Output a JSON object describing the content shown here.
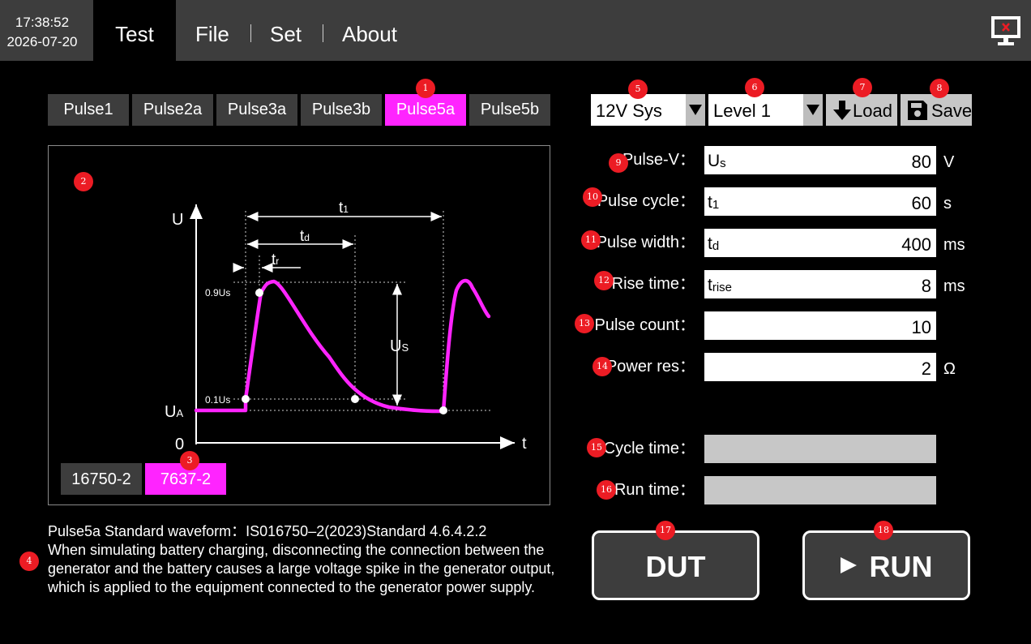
{
  "header": {
    "time": "17:38:52",
    "date": "2026-07-20",
    "menu": [
      "Test",
      "File",
      "Set",
      "About"
    ]
  },
  "pulse_tabs": [
    "Pulse1",
    "Pulse2a",
    "Pulse3a",
    "Pulse3b",
    "Pulse5a",
    "Pulse5b"
  ],
  "active_pulse": "Pulse5a",
  "waveform": {
    "y_axis": "U",
    "x_axis": "t",
    "origin": "0",
    "ua": "U",
    "ua_sub": "A",
    "us": "U",
    "us_sub": "S",
    "t1": "t",
    "t1_sub": "1",
    "td": "t",
    "td_sub": "d",
    "tr": "t",
    "tr_sub": "r",
    "level_09": "0.9Us",
    "level_01": "0.1Us",
    "curve_color": "#ff24ff"
  },
  "standard_tabs": [
    "16750-2",
    "7637-2"
  ],
  "active_standard": "7637-2",
  "description": {
    "title": "Pulse5a Standard waveform：IS016750–2(2023)Standard 4.6.4.2.2",
    "text": "When simulating battery charging, disconnecting the connection between the generator and the battery causes a large voltage spike in the generator output, which is applied to the equipment connected to the generator power supply."
  },
  "controls": {
    "system": "12V Sys",
    "level": "Level 1",
    "load": "Load",
    "save": "Save"
  },
  "params": [
    {
      "label": "Pulse-V：",
      "sym": "U",
      "sub": "s",
      "value": "80",
      "unit": "V"
    },
    {
      "label": "Pulse cycle：",
      "sym": "t",
      "sub": "1",
      "value": "60",
      "unit": "s"
    },
    {
      "label": "Pulse width：",
      "sym": "t",
      "sub": "d",
      "value": "400",
      "unit": "ms"
    },
    {
      "label": "Rise time：",
      "sym": "t",
      "sub": "rise",
      "value": "8",
      "unit": "ms"
    },
    {
      "label": "Pulse count：",
      "sym": "",
      "sub": "",
      "value": "10",
      "unit": ""
    },
    {
      "label": "Power res：",
      "sym": "",
      "sub": "",
      "value": "2",
      "unit": "Ω"
    }
  ],
  "status": {
    "cycle_time_label": "Cycle time：",
    "cycle_time": "",
    "run_time_label": "Run time：",
    "run_time": ""
  },
  "buttons": {
    "dut": "DUT",
    "run": "RUN"
  },
  "badges": [
    "1",
    "2",
    "3",
    "4",
    "5",
    "6",
    "7",
    "8",
    "9",
    "10",
    "11",
    "12",
    "13",
    "14",
    "15",
    "16",
    "17",
    "18"
  ],
  "colors": {
    "accent": "#ff24ff",
    "badge": "#ec1c24",
    "panel": "#3d3d3d"
  }
}
